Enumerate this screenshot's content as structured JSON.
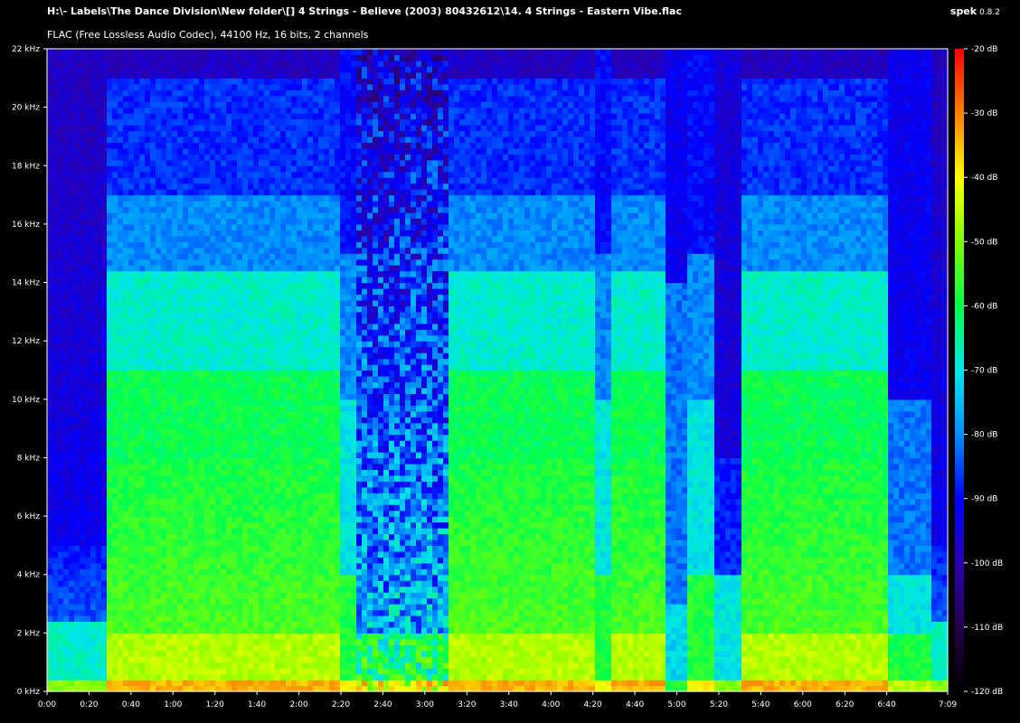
{
  "header": {
    "file_path": "H:\\- Labels\\The Dance Division\\New folder\\[] 4 Strings - Believe (2003) 80432612\\14. 4 Strings - Eastern Vibe.flac",
    "format_info": "FLAC (Free Lossless Audio Codec), 44100 Hz, 16 bits, 2 channels",
    "app_name": "spek",
    "app_version": "0.8.2"
  },
  "colors": {
    "background": "#000000",
    "text": "#ffffff",
    "colormap": [
      "#000000",
      "#25004a",
      "#2a00b0",
      "#0000ff",
      "#0090ff",
      "#00e6e6",
      "#00ff50",
      "#80ff00",
      "#ffff00",
      "#ff8000",
      "#ff0000"
    ]
  },
  "chart_data": {
    "type": "heatmap",
    "title": "",
    "xlabel": "",
    "ylabel": "",
    "x_ticks": [
      "0:00",
      "0:20",
      "0:40",
      "1:00",
      "1:20",
      "1:40",
      "2:00",
      "2:20",
      "2:40",
      "3:00",
      "3:20",
      "3:40",
      "4:00",
      "4:20",
      "4:40",
      "5:00",
      "5:20",
      "5:40",
      "6:00",
      "6:20",
      "6:40",
      "7:09"
    ],
    "x_tick_seconds": [
      0,
      20,
      40,
      60,
      80,
      100,
      120,
      140,
      160,
      180,
      200,
      220,
      240,
      260,
      280,
      300,
      320,
      340,
      360,
      380,
      400,
      429
    ],
    "xlim_seconds": [
      0,
      429
    ],
    "y_ticks": [
      "0 kHz",
      "2 kHz",
      "4 kHz",
      "6 kHz",
      "8 kHz",
      "10 kHz",
      "12 kHz",
      "14 kHz",
      "16 kHz",
      "18 kHz",
      "20 kHz",
      "22 kHz"
    ],
    "y_tick_values": [
      0,
      2,
      4,
      6,
      8,
      10,
      12,
      14,
      16,
      18,
      20,
      22
    ],
    "ylim_khz": [
      0,
      22
    ],
    "colorbar_ticks": [
      "-20 dB",
      "-30 dB",
      "-40 dB",
      "-50 dB",
      "-60 dB",
      "-70 dB",
      "-80 dB",
      "-90 dB",
      "-100 dB",
      "-110 dB",
      "-120 dB"
    ],
    "colorbar_values": [
      -20,
      -30,
      -40,
      -50,
      -60,
      -70,
      -80,
      -90,
      -100,
      -110,
      -120
    ],
    "colorbar_range_db": [
      -120,
      -20
    ],
    "segments": [
      {
        "start": 0,
        "end": 28,
        "profile": "quiet"
      },
      {
        "start": 28,
        "end": 55,
        "profile": "full"
      },
      {
        "start": 55,
        "end": 100,
        "profile": "full"
      },
      {
        "start": 100,
        "end": 140,
        "profile": "full"
      },
      {
        "start": 140,
        "end": 148,
        "profile": "mid"
      },
      {
        "start": 148,
        "end": 175,
        "profile": "break"
      },
      {
        "start": 175,
        "end": 192,
        "profile": "break"
      },
      {
        "start": 192,
        "end": 260,
        "profile": "full"
      },
      {
        "start": 260,
        "end": 270,
        "profile": "mid"
      },
      {
        "start": 270,
        "end": 295,
        "profile": "full"
      },
      {
        "start": 295,
        "end": 305,
        "profile": "dip"
      },
      {
        "start": 305,
        "end": 318,
        "profile": "mid"
      },
      {
        "start": 318,
        "end": 330,
        "profile": "gap"
      },
      {
        "start": 330,
        "end": 400,
        "profile": "full"
      },
      {
        "start": 400,
        "end": 422,
        "profile": "fade"
      },
      {
        "start": 422,
        "end": 429,
        "profile": "quiet"
      }
    ]
  }
}
